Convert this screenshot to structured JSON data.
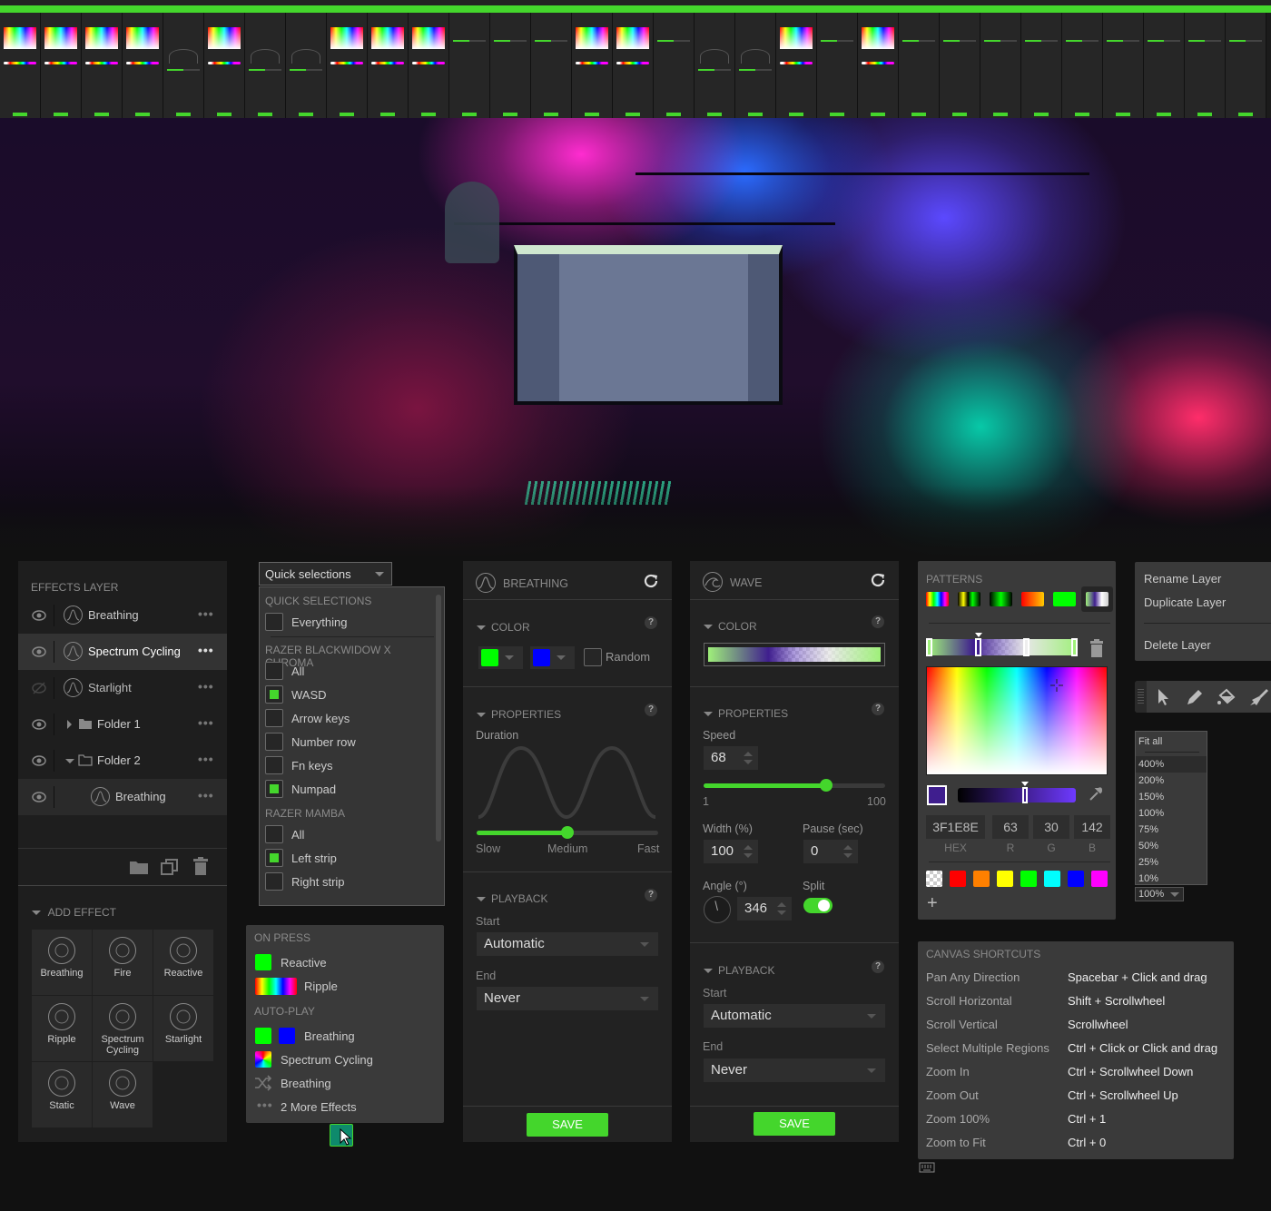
{
  "top_strip": {
    "description": "thumbnail strip of effect editor panels",
    "panel_count": 31,
    "save_label": "SAVE"
  },
  "hero": {
    "description": "photo of a gaming desk setup with RGB lighting and a monitor displaying Chroma Studio"
  },
  "effects_layer": {
    "title": "EFFECTS LAYER",
    "layers": [
      {
        "name": "Breathing",
        "icon": "breathing-icon",
        "visible": true,
        "selected": false,
        "indent": 0
      },
      {
        "name": "Spectrum Cycling",
        "icon": "spectrum-cycling-icon",
        "visible": true,
        "selected": true,
        "indent": 0
      },
      {
        "name": "Starlight",
        "icon": "starlight-icon",
        "visible": false,
        "selected": false,
        "indent": 0
      },
      {
        "name": "Folder 1",
        "icon": "folder-filled-icon",
        "visible": true,
        "selected": false,
        "indent": 0,
        "expanded": false
      },
      {
        "name": "Folder 2",
        "icon": "folder-outline-icon",
        "visible": true,
        "selected": false,
        "indent": 0,
        "expanded": true
      },
      {
        "name": "Breathing",
        "icon": "breathing-icon",
        "visible": true,
        "selected": false,
        "indent": 1
      }
    ],
    "more_label": "•••",
    "footer_icons": [
      "new-folder-icon",
      "duplicate-icon",
      "delete-icon"
    ]
  },
  "add_effect": {
    "title": "ADD EFFECT",
    "effects": [
      {
        "label": "Breathing",
        "icon": "breathing-icon"
      },
      {
        "label": "Fire",
        "icon": "fire-icon"
      },
      {
        "label": "Reactive",
        "icon": "reactive-icon"
      },
      {
        "label": "Ripple",
        "icon": "ripple-icon"
      },
      {
        "label": "Spectrum Cycling",
        "icon": "spectrum-cycling-icon"
      },
      {
        "label": "Starlight",
        "icon": "starlight-icon"
      },
      {
        "label": "Static",
        "icon": "static-icon"
      },
      {
        "label": "Wave",
        "icon": "wave-icon"
      }
    ]
  },
  "quick_selections": {
    "dropdown_label": "Quick selections",
    "groups": [
      {
        "title": "QUICK SELECTIONS",
        "items": [
          {
            "label": "Everything",
            "checked": false
          }
        ]
      },
      {
        "title": "RAZER BLACKWIDOW X CHROMA",
        "items": [
          {
            "label": "All",
            "checked": false
          },
          {
            "label": "WASD",
            "checked": true
          },
          {
            "label": "Arrow keys",
            "checked": false
          },
          {
            "label": "Number row",
            "checked": false
          },
          {
            "label": "Fn keys",
            "checked": false
          },
          {
            "label": "Numpad",
            "checked": true
          }
        ]
      },
      {
        "title": "RAZER MAMBA",
        "items": [
          {
            "label": "All",
            "checked": false
          },
          {
            "label": "Left strip",
            "checked": true
          },
          {
            "label": "Right strip",
            "checked": false
          }
        ]
      }
    ]
  },
  "key_effects_tooltip": {
    "on_press_title": "ON PRESS",
    "on_press": [
      {
        "label": "Reactive",
        "swatch": "green"
      },
      {
        "label": "Ripple",
        "swatch": "rainbow"
      }
    ],
    "auto_play_title": "AUTO-PLAY",
    "auto_play": [
      {
        "label": "Breathing",
        "swatch": "green+blue"
      },
      {
        "label": "Spectrum Cycling",
        "swatch": "spectrum"
      },
      {
        "label": "Breathing",
        "swatch": "random"
      },
      {
        "label": "2 More Effects",
        "swatch": "more"
      }
    ]
  },
  "breathing_panel": {
    "title": "BREATHING",
    "color_section": "COLOR",
    "color1": "#00ff00",
    "color2": "#0000ff",
    "random_label": "Random",
    "random_checked": false,
    "properties_section": "PROPERTIES",
    "duration_label": "Duration",
    "duration_value_fraction": 0.5,
    "slider_labels": [
      "Slow",
      "Medium",
      "Fast"
    ],
    "playback_section": "PLAYBACK",
    "start_label": "Start",
    "start_value": "Automatic",
    "end_label": "End",
    "end_value": "Never",
    "save_label": "SAVE"
  },
  "wave_panel": {
    "title": "WAVE",
    "color_section": "COLOR",
    "properties_section": "PROPERTIES",
    "speed_label": "Speed",
    "speed_value": "68",
    "speed_min": "1",
    "speed_max": "100",
    "speed_fraction": 0.68,
    "width_label": "Width (%)",
    "width_value": "100",
    "pause_label": "Pause (sec)",
    "pause_value": "0",
    "angle_label": "Angle (°)",
    "angle_value": "346",
    "split_label": "Split",
    "split_on": true,
    "playback_section": "PLAYBACK",
    "start_label": "Start",
    "start_value": "Automatic",
    "end_label": "End",
    "end_value": "Never",
    "save_label": "SAVE"
  },
  "color_picker": {
    "patterns_title": "PATTERNS",
    "patterns": [
      "rainbow",
      "yellow-black-green",
      "black-green",
      "red-orange",
      "green",
      "green-purple-white (selected)"
    ],
    "hex": "3F1E8E",
    "r": "63",
    "g": "30",
    "b": "142",
    "hex_label": "HEX",
    "r_label": "R",
    "g_label": "G",
    "b_label": "B",
    "current_color": "#3f1e8e",
    "swatches": [
      "transparent",
      "#ff0000",
      "#ff8000",
      "#ffff00",
      "#00ff00",
      "#00ffff",
      "#0000ff",
      "#ff00ff"
    ],
    "add_label": "+"
  },
  "layer_context_menu": {
    "items": [
      "Rename Layer",
      "Duplicate Layer",
      "Delete Layer"
    ]
  },
  "toolbar": {
    "tools": [
      "select-icon",
      "pencil-icon",
      "fill-bucket-icon",
      "brush-icon"
    ]
  },
  "zoom_menu": {
    "options": [
      "Fit all",
      "400%",
      "200%",
      "150%",
      "100%",
      "75%",
      "50%",
      "25%",
      "10%"
    ],
    "highlighted": "400%",
    "current": "100%"
  },
  "canvas_shortcuts": {
    "title": "CANVAS SHORTCUTS",
    "rows": [
      {
        "action": "Pan Any Direction",
        "keys": "Spacebar + Click and drag"
      },
      {
        "action": "Scroll Horizontal",
        "keys": "Shift + Scrollwheel"
      },
      {
        "action": "Scroll Vertical",
        "keys": "Scrollwheel"
      },
      {
        "action": "Select Multiple Regions",
        "keys": "Ctrl + Click or Click and drag"
      },
      {
        "action": "Zoom In",
        "keys": "Ctrl + Scrollwheel Down"
      },
      {
        "action": "Zoom Out",
        "keys": "Ctrl + Scrollwheel Up"
      },
      {
        "action": "Zoom 100%",
        "keys": "Ctrl + 1"
      },
      {
        "action": "Zoom to Fit",
        "keys": "Ctrl + 0"
      }
    ]
  }
}
